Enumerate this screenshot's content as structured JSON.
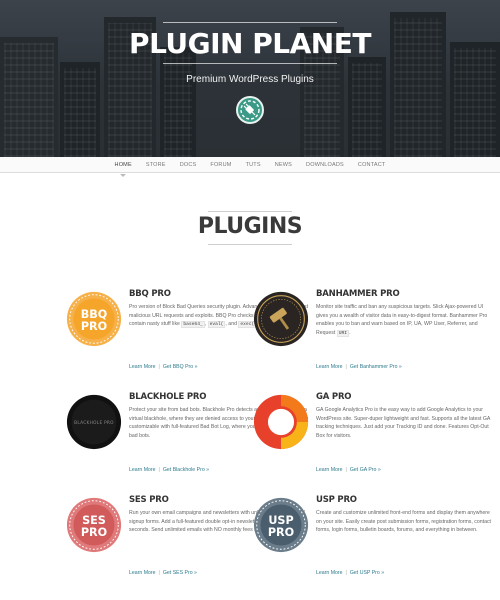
{
  "header": {
    "site_title": "PLUGIN PLANET",
    "tagline": "Premium WordPress Plugins",
    "logo_icon": "plug-icon"
  },
  "nav": {
    "items": [
      {
        "label": "HOME"
      },
      {
        "label": "STORE"
      },
      {
        "label": "DOCS"
      },
      {
        "label": "FORUM"
      },
      {
        "label": "TUTS"
      },
      {
        "label": "NEWS"
      },
      {
        "label": "DOWNLOADS"
      },
      {
        "label": "CONTACT"
      }
    ],
    "active": "HOME"
  },
  "section": {
    "title": "PLUGINS"
  },
  "plugins": [
    {
      "name": "BBQ PRO",
      "badge_text_1": "BBQ",
      "badge_text_2": "PRO",
      "badge_color": "#f4a52a",
      "desc_1": "Pro version of Block Bad Queries security plugin. Advanced protection against malicious URL requests and exploits. BBQ Pro checks all requests that contain nasty stuff like",
      "code_1": "base64_",
      "desc_2": ",",
      "code_2": "eval(",
      "desc_3": ", and",
      "code_3": "exec(",
      "desc_4": ".",
      "learn_more": "Learn More",
      "get": "Get BBQ Pro »"
    },
    {
      "name": "BANHAMMER PRO",
      "badge_color": "#2a2522",
      "desc": "Monitor site traffic and ban any suspicious targets. Slick Ajax-powered UI gives you a wealth of visitor data in easy-to-digest format. Banhammer Pro enables you to ban and warn based on IP, UA, WP User, Referrer, and Request",
      "code": "URI",
      "desc_end": ".",
      "learn_more": "Learn More",
      "get": "Get Banhammer Pro »"
    },
    {
      "name": "BLACKHOLE PRO",
      "badge_text": "BLACKHOLE PRO",
      "badge_color": "#111111",
      "desc": "Protect your site from bad bots. Blackhole Pro detects and traps bad bots in a virtual blackhole, where they are denied access to your entire site. Completely customizable with full-featured Bad Bot Log, where you can view and manage bad bots.",
      "learn_more": "Learn More",
      "get": "Get Blackhole Pro »"
    },
    {
      "name": "GA PRO",
      "badge_color": "#e8412b",
      "desc": "GA Google Analytics Pro is the easy way to add Google Analytics to your WordPress site. Super-duper lightweight and fast. Supports all the latest GA tracking techniques. Just add your Tracking ID and done. Features Opt-Out Box for visitors.",
      "learn_more": "Learn More",
      "get": "Get GA Pro »"
    },
    {
      "name": "SES PRO",
      "badge_text_1": "SES",
      "badge_text_2": "PRO",
      "badge_color": "#d15a5a",
      "desc": "Run your own email campaigns and newsletters with unlimited Ajax-powered signup forms. Add a full-featured double opt-in newsletter to any page in seconds. Send unlimited emails with NO monthly fees and NO restrictions.",
      "learn_more": "Learn More",
      "get": "Get SES Pro »"
    },
    {
      "name": "USP PRO",
      "badge_text_1": "USP",
      "badge_text_2": "PRO",
      "badge_color": "#4a5e6e",
      "desc": "Create and customize unlimited front-end forms and display them anywhere on your site. Easily create post submission forms, registration forms, contact forms, login forms, bulletin boards, forums, and everything in between.",
      "learn_more": "Learn More",
      "get": "Get USP Pro »"
    }
  ]
}
